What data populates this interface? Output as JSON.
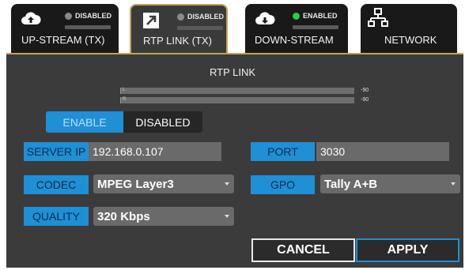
{
  "tabs": [
    {
      "label": "UP-STREAM (TX)",
      "status": "DISABLED",
      "icon": "cloud-upload-icon",
      "active": false
    },
    {
      "label": "RTP LINK (TX)",
      "status": "DISABLED",
      "icon": "link-arrow-icon",
      "active": true
    },
    {
      "label": "DOWN-STREAM",
      "status": "ENABLED",
      "icon": "cloud-download-icon",
      "active": false
    },
    {
      "label": "NETWORK",
      "icon": "network-icon",
      "active": false
    }
  ],
  "panel": {
    "title": "RTP LINK",
    "meters": [
      {
        "channel": "L",
        "value": "-90"
      },
      {
        "channel": "R",
        "value": "-90"
      }
    ],
    "toggle": {
      "enable_label": "ENABLE",
      "disable_label": "DISABLED",
      "selected": "ENABLE"
    },
    "server_ip": {
      "label": "SERVER IP",
      "value": "192.168.0.107"
    },
    "port": {
      "label": "PORT",
      "value": "3030"
    },
    "codec": {
      "label": "CODEC",
      "value": "MPEG Layer3"
    },
    "gpo": {
      "label": "GPO",
      "value": "Tally A+B"
    },
    "quality": {
      "label": "QUALITY",
      "value": "320 Kbps"
    }
  },
  "buttons": {
    "cancel": "CANCEL",
    "apply": "APPLY"
  },
  "colors": {
    "accent": "#1f8fd6",
    "active_border": "#c8a050",
    "status_on": "#2ecc40",
    "status_off": "#8a8a8a"
  }
}
